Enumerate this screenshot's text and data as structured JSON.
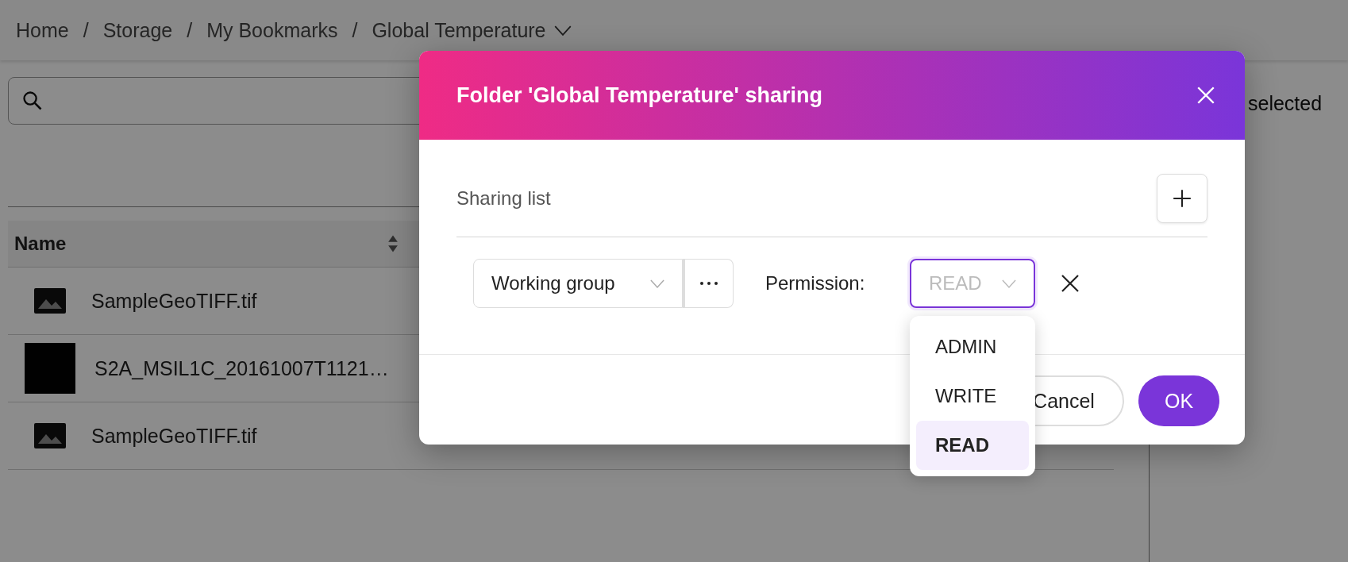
{
  "breadcrumb": {
    "items": [
      "Home",
      "Storage",
      "My Bookmarks",
      "Global Temperature"
    ],
    "separator": "/"
  },
  "table": {
    "columns": [
      {
        "label": "Name",
        "sortable": true
      }
    ],
    "rows": [
      {
        "name": "SampleGeoTIFF.tif",
        "kind": "icon"
      },
      {
        "name": "S2A_MSIL1C_20161007T1121…",
        "kind": "photo"
      },
      {
        "name": "SampleGeoTIFF.tif",
        "kind": "icon"
      }
    ]
  },
  "side_panel": {
    "text": "selected"
  },
  "dialog": {
    "title": "Folder 'Global Temperature' sharing",
    "sharing_list_label": "Sharing list",
    "entries": [
      {
        "group": "Working group",
        "permission_label": "Permission:",
        "permission_value": "READ",
        "expanded": true
      }
    ],
    "permission_options": [
      {
        "label": "ADMIN",
        "selected": false
      },
      {
        "label": "WRITE",
        "selected": false
      },
      {
        "label": "READ",
        "selected": true
      }
    ],
    "buttons": [
      {
        "label": "Cancel",
        "kind": "secondary"
      },
      {
        "label": "OK",
        "kind": "primary"
      }
    ]
  }
}
